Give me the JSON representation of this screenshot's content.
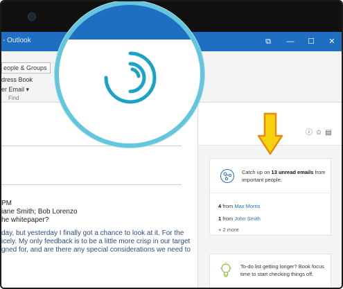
{
  "window": {
    "app_title": "- Outlook",
    "controls": {
      "ribbon_display": "⧉",
      "minimize": "—",
      "maximize": "☐",
      "close": "✕"
    }
  },
  "ribbon": {
    "people_groups": "eople & Groups",
    "address_book": "dress Book",
    "filter_email": "er Email ▾",
    "group_label": "Find"
  },
  "message": {
    "time": "PM",
    "to": "iane Smith; Bob Lorenzo",
    "subject": "he whitepaper?",
    "body_lines": [
      "day, but yesterday I finally got a chance to look at it. For the",
      "icely. My only feedback is to be a little more crisp in our target",
      "gned for, and are there any special considerations we need to",
      "",
      ""
    ]
  },
  "insights_pane": {
    "icons": [
      "info-icon",
      "smile-icon",
      "book-icon"
    ],
    "unread_card": {
      "text_prefix": "Catch up on ",
      "highlight": "13 unread emails",
      "text_suffix": " from important people.",
      "rows": [
        {
          "count": "4",
          "from_label": " from ",
          "sender": "Max Morris"
        },
        {
          "count": "1",
          "from_label": " from ",
          "sender": "John Smith"
        }
      ],
      "more": "+ 2 more"
    },
    "todo_card": {
      "text": "To-do list getting longer? Book focus time to start checking things off."
    }
  },
  "colors": {
    "title_bar": "#1e6fc1",
    "magnifier_ring": "#63c6de",
    "spinner": "#1aa3c6",
    "arrow_fill": "#f5d20e",
    "arrow_stroke": "#e88a0c"
  }
}
